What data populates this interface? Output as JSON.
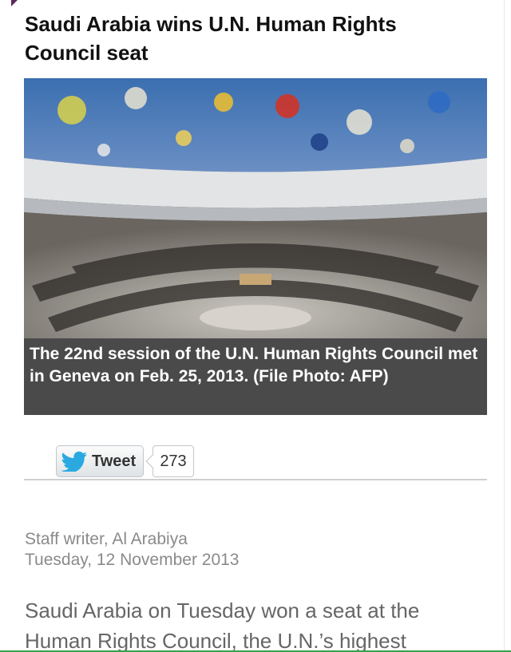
{
  "article": {
    "headline": "Saudi Arabia wins U.N. Human Rights Council seat",
    "photo_caption": "The 22nd session of the U.N. Human Rights Council met in Geneva on Feb. 25, 2013. (File Photo: AFP)",
    "byline_author": "Staff writer, Al Arabiya",
    "byline_date": "Tuesday, 12 November 2013",
    "body_snippet": "Saudi Arabia on Tuesday won a seat at the Human Rights Council, the U.N.’s highest"
  },
  "share": {
    "tweet_label": "Tweet",
    "tweet_count": "273",
    "icon": "twitter-bird-icon"
  },
  "colors": {
    "caption_bg": "#4a4a4a",
    "twitter_blue": "#2aa9e0",
    "accent_green": "#3aa14a"
  }
}
